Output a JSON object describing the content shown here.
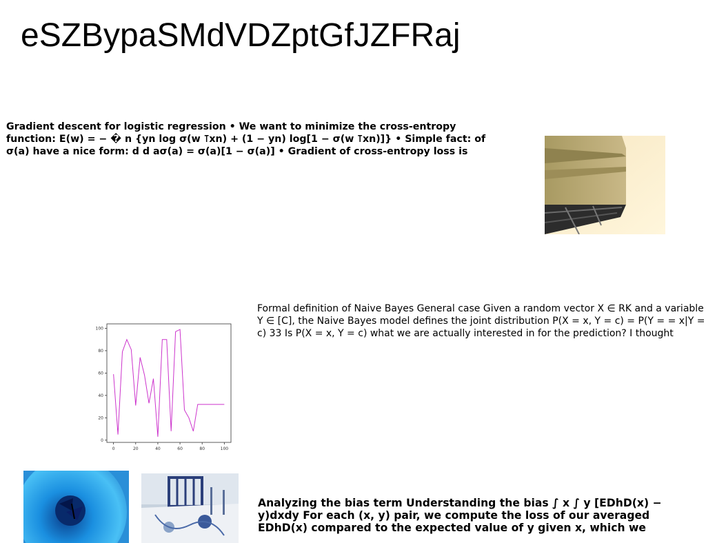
{
  "title": "eSZBypaSMdVDZptGfJZFRaj",
  "paragraphs": {
    "logistic": "Gradient descent for logistic regression • We want to minimize the cross-entropy function: E(w) = − � n {yn log σ(w ⊺xn) + (1 − yn) log[1 − σ(w ⊺xn)]} • Simple fact: of σ(a) have a nice form: d d aσ(a) = σ(a)[1 − σ(a)] • Gradient of cross-entropy loss is",
    "naive_bayes": "Formal definition of Naive Bayes General case Given a random vector X ∈ RK and a variable Y ∈ [C], the Naive Bayes model defines the joint distribution P(X = x, Y = c) = P(Y = = x|Y = c) 33 Is P(X = x, Y = c) what we are actually interested in for the prediction? I thought",
    "bias": "Analyzing the bias term Understanding the bias ∫ x ∫ y [EDhD(x) − y)dxdy For each (x, y) pair, we compute the loss of our averaged EDhD(x) compared to the expected value of y given x, which we"
  },
  "chart_data": {
    "type": "line",
    "x": [
      0,
      4,
      8,
      12,
      16,
      20,
      24,
      28,
      32,
      36,
      40,
      44,
      48,
      52,
      56,
      60,
      64,
      68,
      72,
      76,
      80,
      84,
      88,
      92,
      96,
      100
    ],
    "series": [
      {
        "values": [
          59,
          5,
          79,
          90,
          81,
          31,
          74,
          58,
          33,
          55,
          3,
          90,
          90,
          8,
          97,
          99,
          27,
          20,
          8,
          32,
          32,
          32,
          32,
          32,
          32,
          32
        ],
        "color": "#cc33cc"
      }
    ],
    "xticks": [
      "0",
      "20",
      "40",
      "60",
      "80",
      "100"
    ],
    "yticks": [
      "0",
      "20",
      "40",
      "60",
      "80",
      "100"
    ],
    "xlim": [
      -6,
      106
    ],
    "ylim": [
      -2,
      104
    ],
    "grid": false
  }
}
